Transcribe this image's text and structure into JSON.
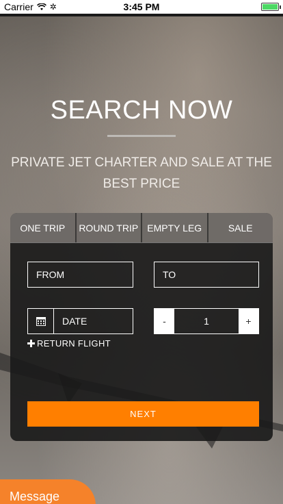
{
  "status_bar": {
    "carrier": "Carrier",
    "time": "3:45 PM"
  },
  "hero": {
    "title": "SEARCH NOW",
    "subtitle": "PRIVATE JET CHARTER AND SALE AT THE BEST PRICE"
  },
  "tabs": [
    {
      "label": "ONE TRIP"
    },
    {
      "label": "ROUND TRIP"
    },
    {
      "label": "EMPTY LEG"
    },
    {
      "label": "SALE"
    }
  ],
  "form": {
    "from_placeholder": "FROM",
    "to_placeholder": "TO",
    "date_placeholder": "DATE",
    "passengers": "1",
    "minus_label": "-",
    "plus_label": "+",
    "return_flight_label": "RETURN FLIGHT",
    "next_label": "NEXT"
  },
  "message_label": "Message",
  "colors": {
    "accent": "#ff7f00",
    "message_bubble": "#f5822a",
    "panel": "#191919"
  }
}
